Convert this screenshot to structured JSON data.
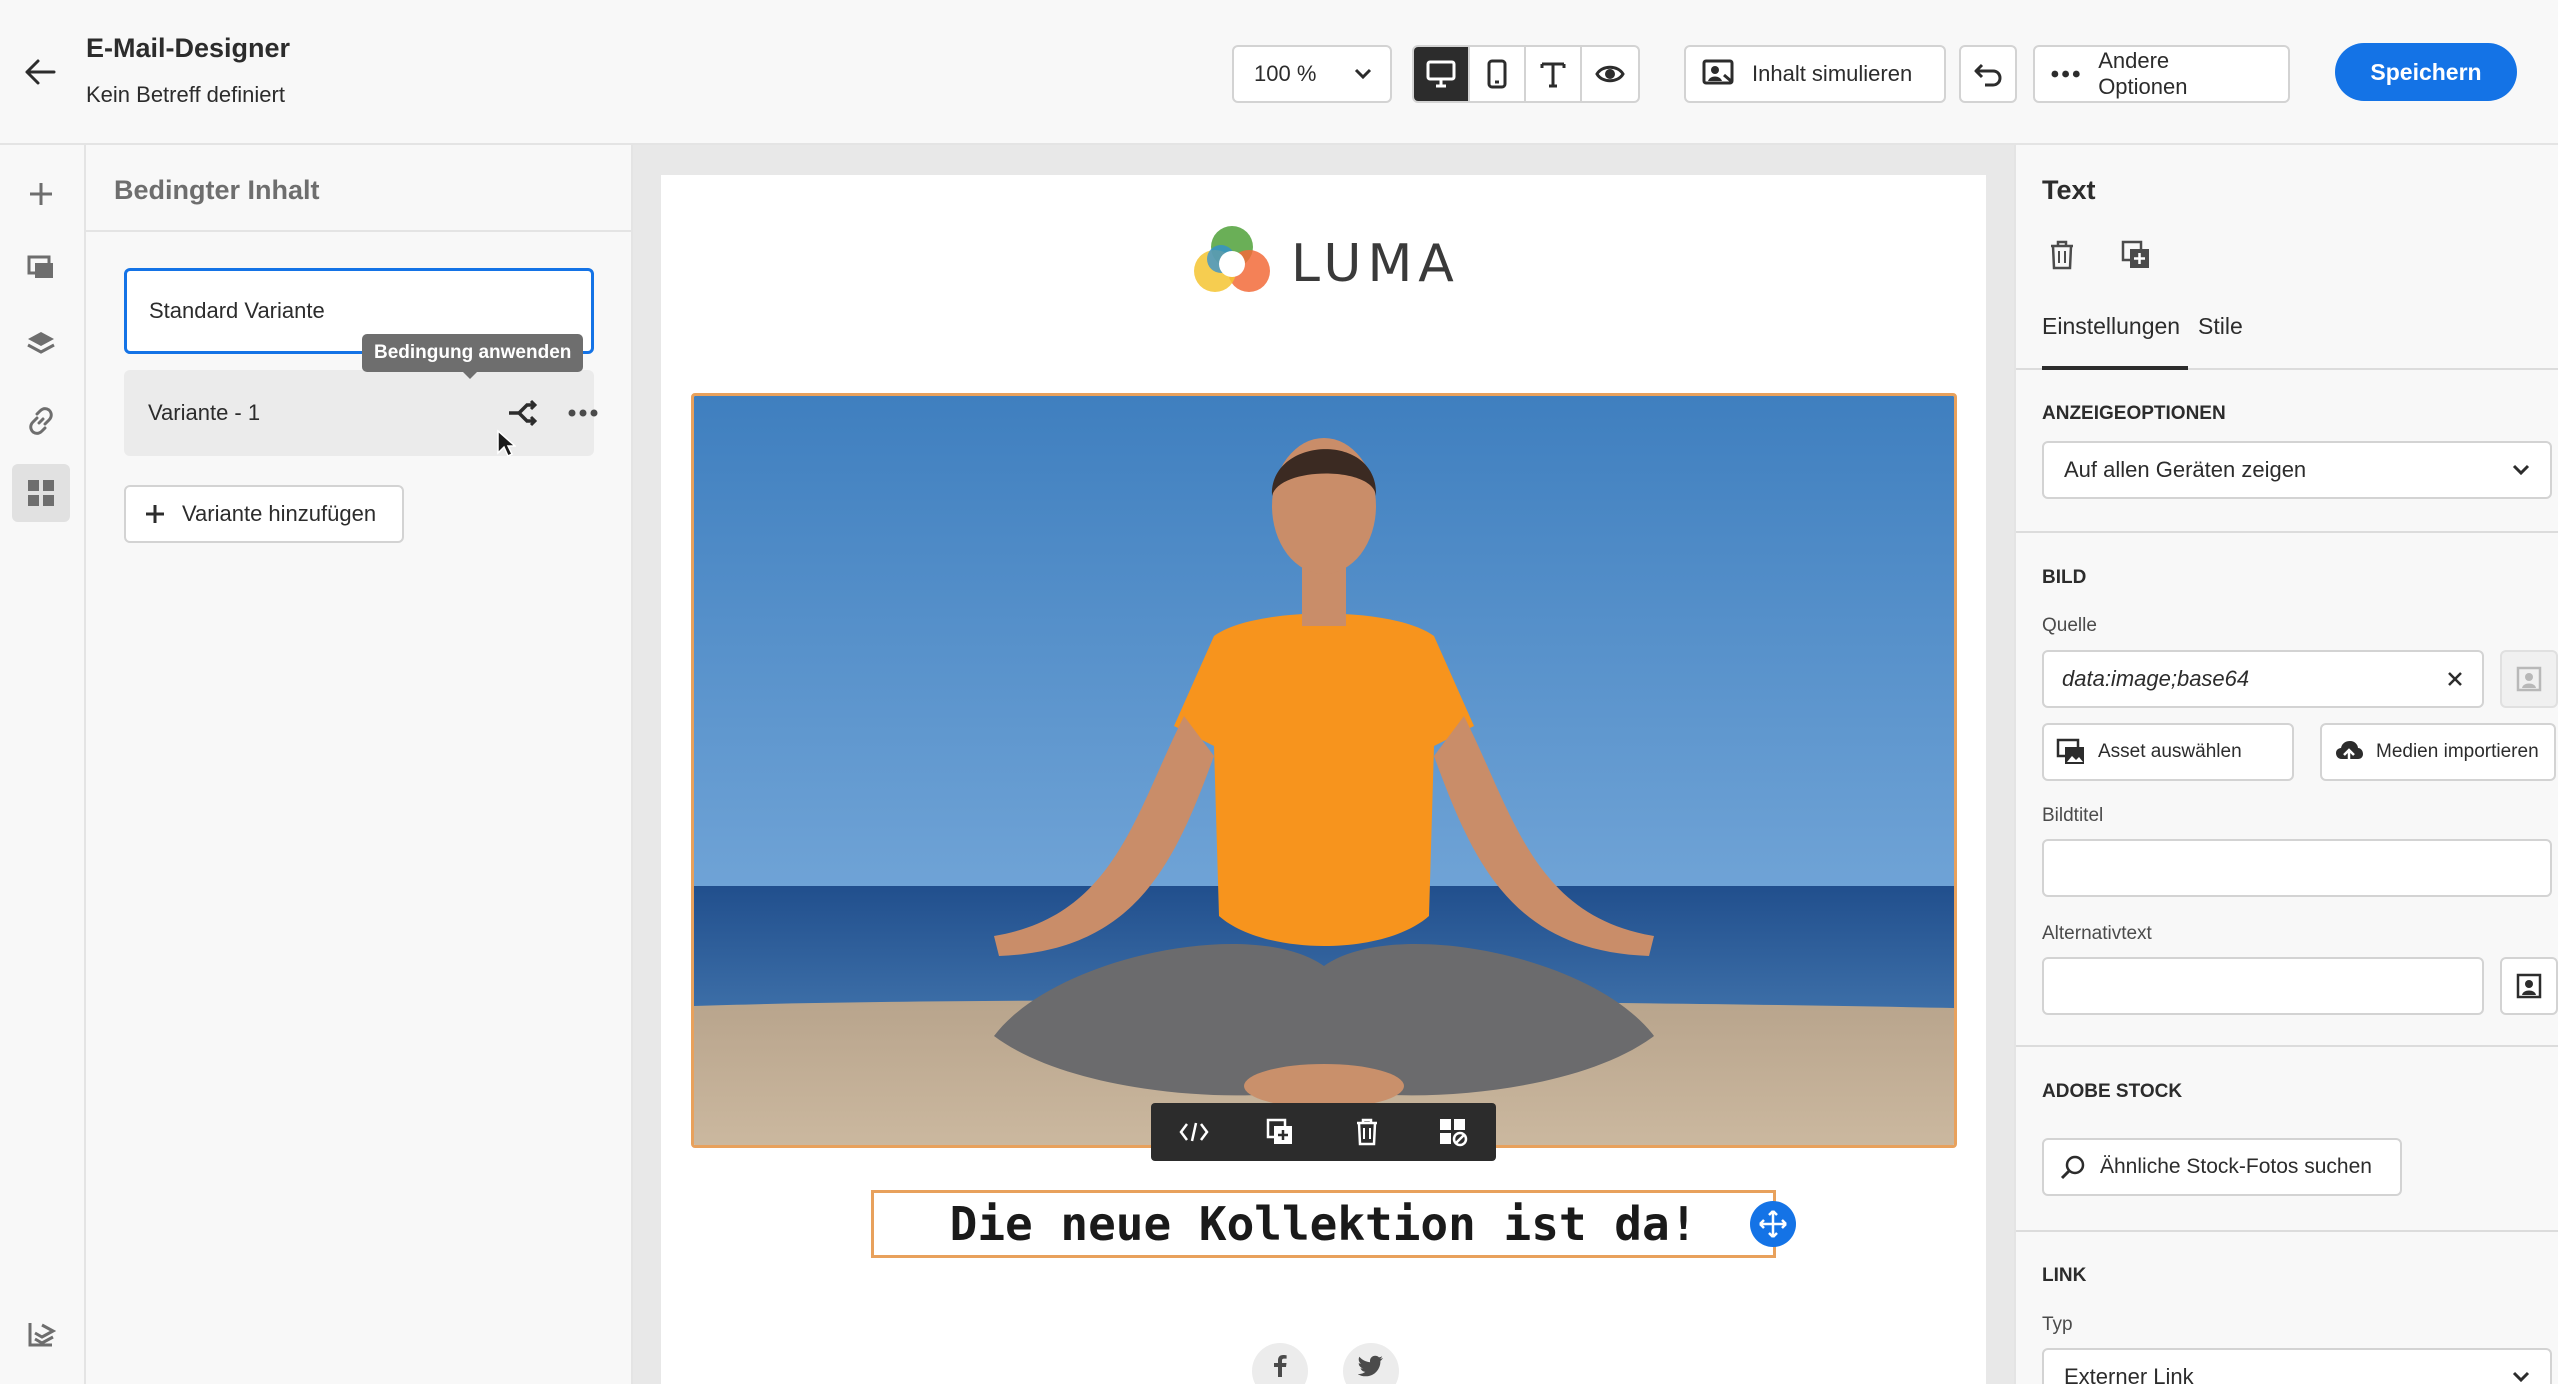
{
  "header": {
    "title": "E-Mail-Designer",
    "subtitle": "Kein Betreff definiert",
    "zoom": "100 %",
    "simulate_label": "Inhalt simulieren",
    "more_options_label": "Andere Optionen",
    "save_label": "Speichern",
    "accent": "#1473e6"
  },
  "conditional_panel": {
    "title": "Bedingter Inhalt",
    "default_variant": "Standard Variante",
    "variant_1": "Variante - 1",
    "tooltip": "Bedingung anwenden",
    "add_variant": "Variante hinzufügen"
  },
  "email": {
    "logo_text": "LUMA",
    "headline": "Die neue Kollektion ist da!"
  },
  "properties": {
    "title": "Text",
    "tabs": [
      "Einstellungen",
      "Stile"
    ],
    "display_options_label": "ANZEIGEOPTIONEN",
    "display_options_value": "Auf allen Geräten zeigen",
    "image_section": "BILD",
    "source_label": "Quelle",
    "source_value": "data:image;base64",
    "select_asset": "Asset auswählen",
    "import_media": "Medien importieren",
    "image_title_label": "Bildtitel",
    "alt_text_label": "Alternativtext",
    "adobe_stock_label": "ADOBE STOCK",
    "stock_search": "Ähnliche Stock-Fotos suchen",
    "link_label": "LINK",
    "type_label": "Typ",
    "type_value": "Externer Link"
  }
}
